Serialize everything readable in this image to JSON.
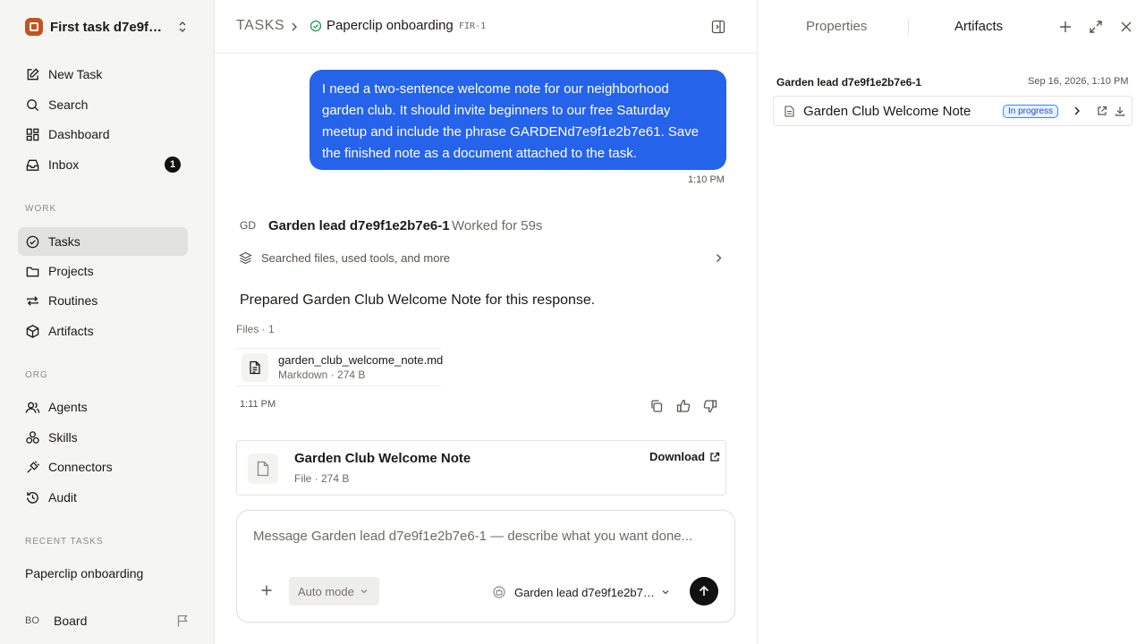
{
  "workspace": {
    "name": "First task d7e9f1..."
  },
  "nav": {
    "top": [
      {
        "label": "New Task",
        "icon": "edit-icon"
      },
      {
        "label": "Search",
        "icon": "search-icon"
      },
      {
        "label": "Dashboard",
        "icon": "dashboard-icon"
      },
      {
        "label": "Inbox",
        "icon": "inbox-icon",
        "badge": "1"
      }
    ],
    "work_label": "WORK",
    "work": [
      {
        "label": "Tasks",
        "icon": "check-circle-icon",
        "active": true
      },
      {
        "label": "Projects",
        "icon": "folder-icon"
      },
      {
        "label": "Routines",
        "icon": "repeat-icon"
      },
      {
        "label": "Artifacts",
        "icon": "box-icon"
      }
    ],
    "org_label": "ORG",
    "org": [
      {
        "label": "Agents",
        "icon": "users-icon"
      },
      {
        "label": "Skills",
        "icon": "skills-icon"
      },
      {
        "label": "Connectors",
        "icon": "plug-icon"
      },
      {
        "label": "Audit",
        "icon": "history-icon"
      }
    ],
    "recent_label": "RECENT TASKS",
    "recent": [
      "Paperclip onboarding"
    ],
    "board": {
      "avatar": "BO",
      "name": "Board"
    }
  },
  "header": {
    "root": "TASKS",
    "title": "Paperclip onboarding",
    "id": "FIR-1"
  },
  "conversation": {
    "user_message": "I need a two-sentence welcome note for our neighborhood garden club. It should invite beginners to our free Saturday meetup and include the phrase GARDENd7e9f1e2b7e61. Save the finished note as a document attached to the task.",
    "user_time": "1:10 PM",
    "agent": {
      "avatar": "GD",
      "name": "Garden lead d7e9f1e2b7e6-1",
      "worked": "Worked for 59s",
      "tools_summary": "Searched files, used tools, and more",
      "response": "Prepared Garden Club Welcome Note for this response.",
      "files_label": "Files · 1",
      "file": {
        "name": "garden_club_welcome_note.md",
        "meta": "Markdown · 274 B"
      },
      "time": "1:11 PM"
    },
    "document": {
      "title": "Garden Club Welcome Note",
      "meta": "File · 274 B",
      "download_label": "Download"
    }
  },
  "composer": {
    "placeholder": "Message Garden lead d7e9f1e2b7e6-1 — describe what you want done...",
    "mode": "Auto mode",
    "agent": "Garden lead d7e9f1e2b7e6-1"
  },
  "right_panel": {
    "tabs": {
      "properties": "Properties",
      "artifacts": "Artifacts"
    },
    "owner": "Garden lead d7e9f1e2b7e6-1",
    "date": "Sep 16, 2026, 1:10 PM",
    "artifact": {
      "name": "Garden Club Welcome Note",
      "status": "In progress"
    }
  },
  "colors": {
    "accent": "#2563eb",
    "status": "#3b82f6",
    "brand": "#c2541f"
  }
}
